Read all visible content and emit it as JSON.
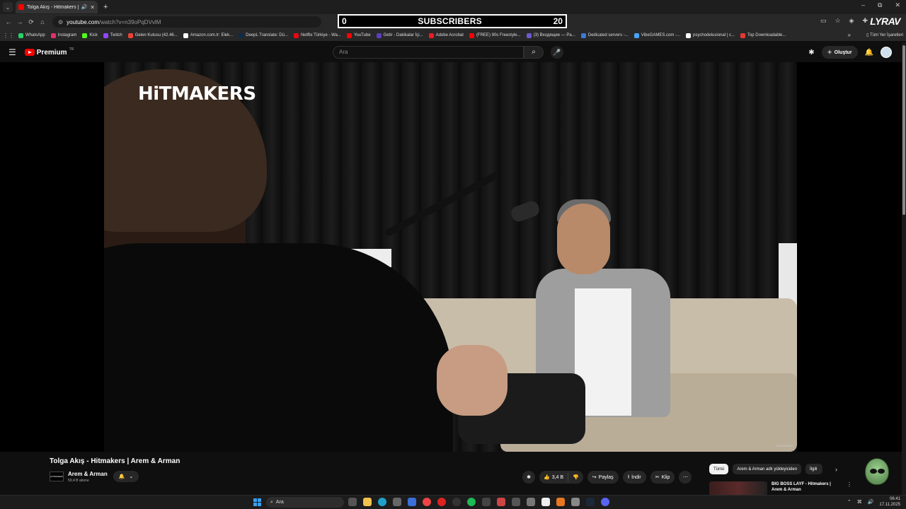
{
  "browser": {
    "tab_title": "Tolga Akış - Hitmakers | Ar",
    "tab_menu_icon": "chevron-down-icon",
    "new_tab": "+",
    "url_host": "youtube.com",
    "url_path": "/watch?v=n39oPqDVvlM",
    "logo_text": "LYRAV",
    "window": {
      "minimize": "–",
      "restore": "⧉",
      "close": "✕"
    }
  },
  "overlay": {
    "left_count": "0",
    "label": "SUBSCRIBERS",
    "right_count": "20"
  },
  "bookmarks": [
    {
      "label": "WhatsApp",
      "color": "#25d366"
    },
    {
      "label": "Instagram",
      "color": "#e1306c"
    },
    {
      "label": "Kick",
      "color": "#53fc18"
    },
    {
      "label": "Twitch",
      "color": "#9146ff"
    },
    {
      "label": "Gelen Kutusu (42.46...",
      "color": "#ea4335"
    },
    {
      "label": "Amazon.com.tr: Elek...",
      "color": "#ffffff"
    },
    {
      "label": "DeepL Translate: Dü...",
      "color": "#0f2b46"
    },
    {
      "label": "Netflix Türkiye - Wa...",
      "color": "#e50914"
    },
    {
      "label": "YouTube",
      "color": "#ff0000"
    },
    {
      "label": "Getir - Dakikalar İçi...",
      "color": "#5d3ebc"
    },
    {
      "label": "Adobe Acrobat",
      "color": "#ec1c24"
    },
    {
      "label": "(FREE) 90s Freestyle...",
      "color": "#ff0000"
    },
    {
      "label": "(3) Входящие — Pa...",
      "color": "#6a5acd"
    },
    {
      "label": "Dedicated servers -...",
      "color": "#3a7bd5"
    },
    {
      "label": "VibeGAMES.com -...",
      "color": "#4aa3ff"
    },
    {
      "label": "psychodelusional | c...",
      "color": "#ffffff"
    },
    {
      "label": "Top Downloadable...",
      "color": "#e53935"
    }
  ],
  "bookmarks_more": "»",
  "bookmarks_all": "Tüm Yer İşaretleri",
  "yt": {
    "logo": "Premium",
    "region": "TR",
    "search_placeholder": "Ara",
    "create_label": "Oluştur"
  },
  "video": {
    "brand_overlay": "HiTMAKERS",
    "corner_mark": "HITMAKERS"
  },
  "meta": {
    "title": "Tolga Akış - Hitmakers | Arem & Arman",
    "channel_badge": "HITMAKERS",
    "channel": "Arem & Arman",
    "subscribers": "59,4 B abone",
    "likes": "3,4 B",
    "share": "Paylaş",
    "download": "İndir",
    "clip": "Klip"
  },
  "chips": [
    "Tümü",
    "Arem & Arman adlı yükleyiciden",
    "İlgili"
  ],
  "recommended": {
    "title": "BIG BOSS LAYF - Hitmakers | Arem & Arman"
  },
  "taskbar": {
    "search": "Ara",
    "time": "06:41",
    "date": "17.11.2025"
  }
}
